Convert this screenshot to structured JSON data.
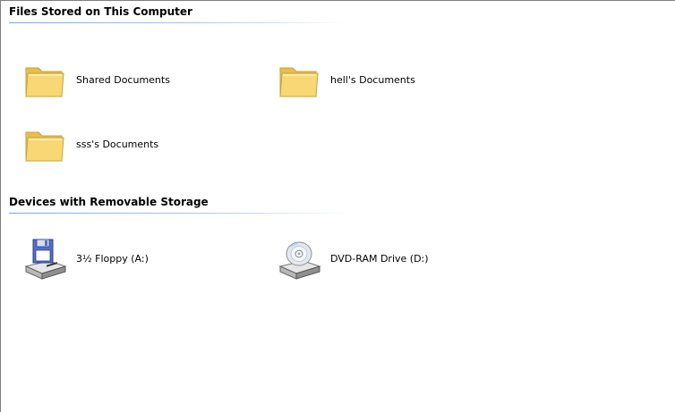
{
  "groups": {
    "files": {
      "header": "Files Stored on This Computer",
      "items": [
        {
          "label": "Shared Documents",
          "icon": "folder-icon"
        },
        {
          "label": "hell's Documents",
          "icon": "folder-icon"
        },
        {
          "label": "sss's Documents",
          "icon": "folder-icon"
        }
      ]
    },
    "devices": {
      "header": "Devices with Removable Storage",
      "items": [
        {
          "label": "3½ Floppy (A:)",
          "icon": "floppy-drive-icon"
        },
        {
          "label": "DVD-RAM Drive (D:)",
          "icon": "dvd-drive-icon"
        }
      ]
    }
  },
  "colors": {
    "group_line": "#7aa7e2",
    "folder_body": "#f6d36a",
    "folder_edge": "#c9a23a"
  }
}
